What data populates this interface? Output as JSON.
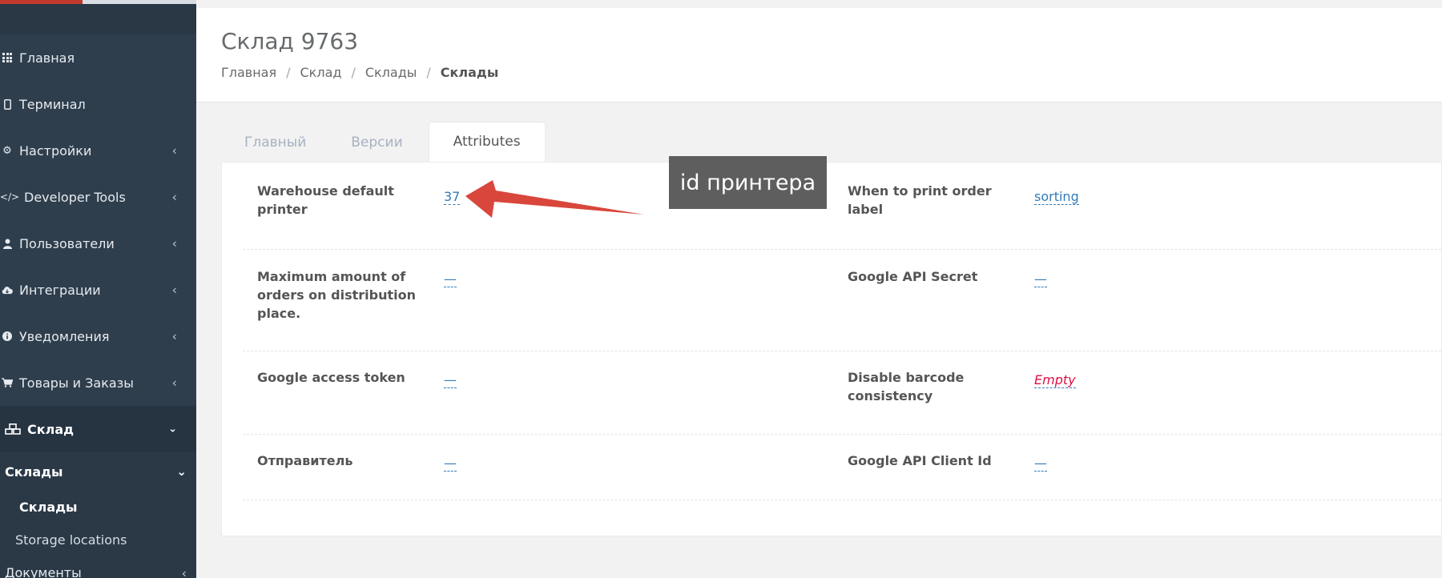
{
  "sidebar": {
    "items": [
      {
        "label": "Главная",
        "icon": "grid-icon"
      },
      {
        "label": "Терминал",
        "icon": "tablet-icon"
      },
      {
        "label": "Настройки",
        "icon": "gear-icon"
      },
      {
        "label": "Developer Tools",
        "icon": "code-icon"
      },
      {
        "label": "Пользователи",
        "icon": "user-icon"
      },
      {
        "label": "Интеграции",
        "icon": "cloud-icon"
      },
      {
        "label": "Уведомления",
        "icon": "info-icon"
      },
      {
        "label": "Товары и Заказы",
        "icon": "cart-icon"
      },
      {
        "label": "Склад",
        "icon": "cubes-icon"
      }
    ],
    "warehouse_group": {
      "label": "Склады",
      "children": [
        "Склады",
        "Storage locations"
      ]
    },
    "documents": "Документы"
  },
  "page": {
    "title": "Склад 9763",
    "breadcrumb": [
      "Главная",
      "Склад",
      "Склады",
      "Склады"
    ]
  },
  "tabs": [
    "Главный",
    "Версии",
    "Attributes"
  ],
  "active_tab": "Attributes",
  "attributes": {
    "left": [
      {
        "label_lines": [
          "Warehouse default",
          "printer"
        ],
        "value": "37"
      },
      {
        "label_lines": [
          "Maximum amount of",
          "orders on distribution",
          "place."
        ],
        "value": "—"
      },
      {
        "label_lines": [
          "Google access token"
        ],
        "value": "—"
      },
      {
        "label_lines": [
          "Отправитель"
        ],
        "value": "—"
      }
    ],
    "right": [
      {
        "label_lines": [
          "When to print order",
          "label"
        ],
        "value": "sorting"
      },
      {
        "label_lines": [
          "Google API Secret"
        ],
        "value": "—"
      },
      {
        "label_lines": [
          "Disable barcode",
          "consistency"
        ],
        "value": "Empty"
      },
      {
        "label_lines": [
          "Google API Client Id"
        ],
        "value": "—"
      }
    ]
  },
  "annotation": {
    "text": "id принтера",
    "arrow_color": "#d9463b"
  }
}
